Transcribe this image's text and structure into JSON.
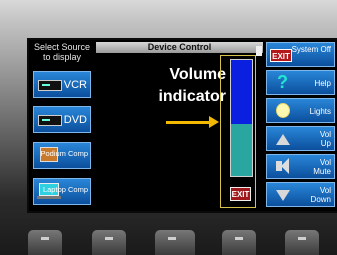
{
  "source_panel": {
    "title": "Select Source to display",
    "buttons": [
      {
        "label": "VCR",
        "icon": "vcr-icon"
      },
      {
        "label": "DVD",
        "icon": "dvd-icon"
      },
      {
        "label": "Podium Comp",
        "icon": "podium-computer-icon"
      },
      {
        "label": "Laptop Comp",
        "icon": "laptop-icon"
      }
    ]
  },
  "device_control": {
    "title": "Device Control",
    "annotation": "Volume indicator",
    "volume_level_fraction": 0.45,
    "exit_label": "EXIT"
  },
  "system_panel": {
    "system_off": {
      "exit_label": "EXIT",
      "label": "System Off"
    },
    "help": {
      "label": "Help"
    },
    "lights": {
      "label": "Lights"
    },
    "vol_up": {
      "label": "Vol Up"
    },
    "vol_mute": {
      "label": "Vol Mute"
    },
    "vol_down": {
      "label": "Vol Down"
    }
  },
  "colors": {
    "accent_blue": "#0b4f9d",
    "exit_red": "#b3181a",
    "volume_blue": "#0b1fe0",
    "volume_teal": "#2aa6a0",
    "arrow_yellow": "#f2b900"
  }
}
